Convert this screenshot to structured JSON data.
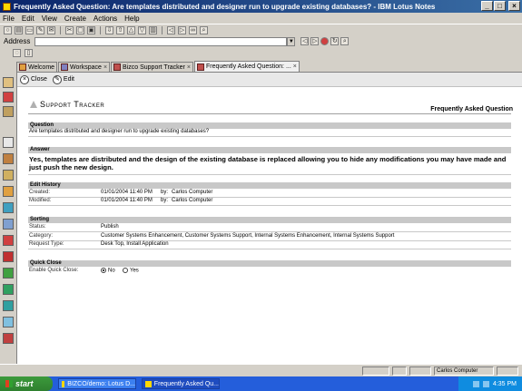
{
  "window": {
    "title": "Frequently Asked Question: Are templates distributed and designer run to upgrade existing databases? - IBM Lotus Notes"
  },
  "menu": [
    "File",
    "Edit",
    "View",
    "Create",
    "Actions",
    "Help"
  ],
  "address": {
    "label": "Address",
    "value": ""
  },
  "tabs": [
    {
      "label": "Welcome",
      "icon": "home-icon"
    },
    {
      "label": "Workspace",
      "icon": "workspace-icon"
    },
    {
      "label": "Bizco Support Tracker",
      "icon": "database-icon"
    },
    {
      "label": "Frequently Asked Question: ...",
      "icon": "document-icon",
      "active": true
    }
  ],
  "actions": {
    "close": "Close",
    "edit": "Edit"
  },
  "document": {
    "app_title": "Support Tracker",
    "form_name": "Frequently Asked Question",
    "question_header": "Question",
    "question": "Are templates distributed and designer run to upgrade existing databases?",
    "answer_header": "Answer",
    "answer": "Yes, templates are distributed and the design of the existing database is replaced allowing you to hide any modifications you may have made and just push the new design.",
    "edit_history_header": "Edit History",
    "created_label": "Created:",
    "created_value": "01/01/2004 11:40 PM",
    "created_by_label": "by:",
    "created_by": "Carlos Computer",
    "modified_label": "Modified:",
    "modified_value": "01/01/2004 11:40 PM",
    "modified_by_label": "by:",
    "modified_by": "Carlos Computer",
    "sorting_header": "Sorting",
    "status_label": "Status:",
    "status_value": "Publish",
    "category_label": "Category:",
    "category_value": "Customer Systems Enhancement, Customer Systems Support, Internal Systems Enhancement, Internal Systems Support",
    "request_type_label": "Request Type:",
    "request_type_value": "Desk Top, Install Application",
    "quick_close_header": "Quick Close",
    "enable_quick_close_label": "Enable Quick Close:",
    "quick_close_no": "No",
    "quick_close_yes": "Yes",
    "quick_close_selected": "No"
  },
  "statusbar": {
    "user": "Carlos Computer"
  },
  "taskbar": {
    "start": "start",
    "tasks": [
      {
        "label": "BIZCO/demo: Lotus D..."
      },
      {
        "label": "Frequently Asked Qu..."
      }
    ],
    "clock": "4:35 PM"
  }
}
